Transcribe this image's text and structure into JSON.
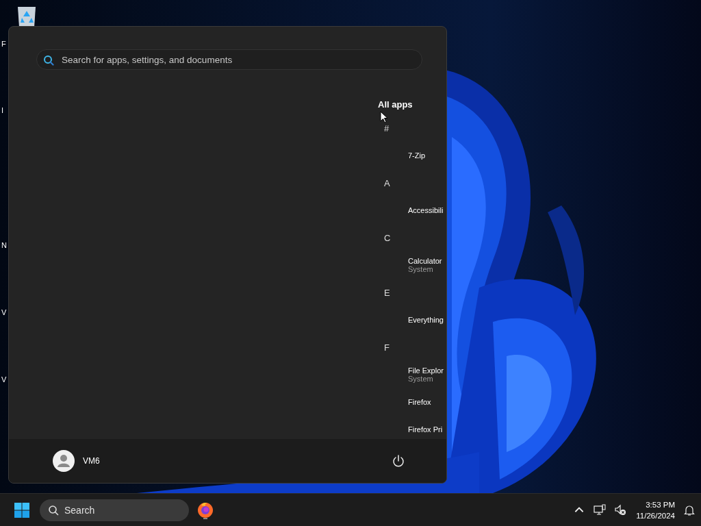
{
  "desktop": {
    "icon_labels": [
      "F",
      "I",
      "N",
      "V",
      "V"
    ]
  },
  "start_menu": {
    "search": {
      "placeholder": "Search for apps, settings, and documents"
    },
    "all_apps": {
      "title": "All apps",
      "groups": [
        {
          "letter": "#",
          "apps": [
            {
              "name": "7-Zip"
            }
          ]
        },
        {
          "letter": "A",
          "apps": [
            {
              "name": "Accessibili"
            }
          ]
        },
        {
          "letter": "C",
          "apps": [
            {
              "name": "Calculator",
              "subtitle": "System"
            }
          ]
        },
        {
          "letter": "E",
          "apps": [
            {
              "name": "Everything"
            }
          ]
        },
        {
          "letter": "F",
          "apps": [
            {
              "name": "File Explor",
              "subtitle": "System"
            },
            {
              "name": "Firefox"
            },
            {
              "name": "Firefox Pri"
            }
          ]
        }
      ]
    },
    "user": {
      "name": "VM6"
    }
  },
  "taskbar": {
    "search": {
      "placeholder": "Search"
    },
    "clock": {
      "time": "3:53 PM",
      "date": "11/26/2024"
    }
  }
}
